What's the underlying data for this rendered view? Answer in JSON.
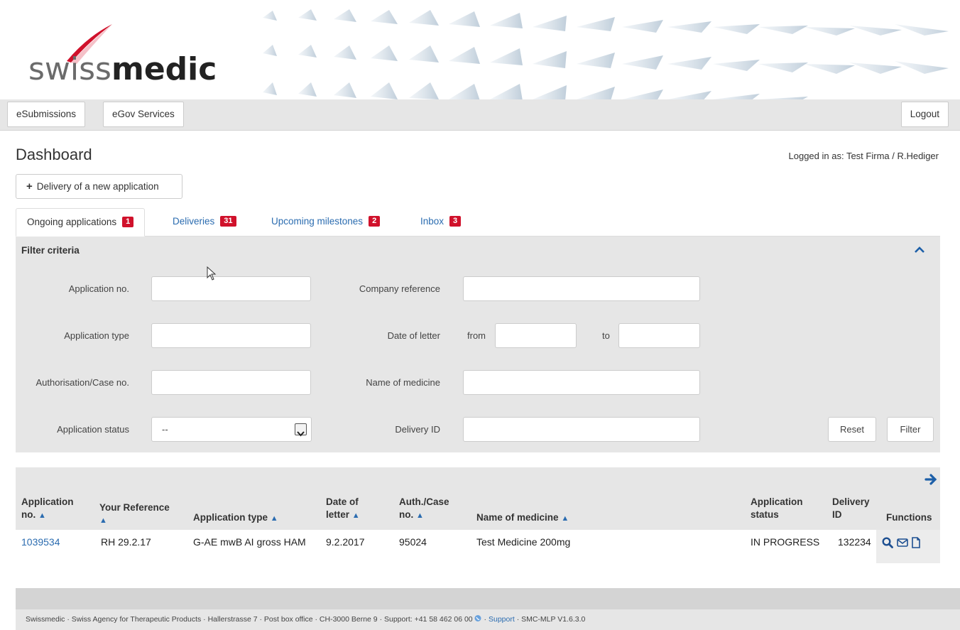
{
  "header": {
    "logo_light": "swiss",
    "logo_bold": "medic"
  },
  "topbar": {
    "esubmissions": "eSubmissions",
    "egov": "eGov Services",
    "logout": "Logout"
  },
  "page": {
    "title": "Dashboard",
    "logged_in": "Logged in as:  Test Firma /  R.Hediger",
    "new_app_label": "Delivery of a new application"
  },
  "tabs": [
    {
      "label": "Ongoing applications",
      "badge": "1"
    },
    {
      "label": "Deliveries",
      "badge": "31"
    },
    {
      "label": "Upcoming milestones",
      "badge": "2"
    },
    {
      "label": "Inbox",
      "badge": "3"
    }
  ],
  "filter": {
    "title": "Filter criteria",
    "application_no": "Application no.",
    "application_type": "Application type",
    "authorisation_case_no": "Authorisation/Case no.",
    "application_status": "Application status",
    "application_status_value": "--",
    "company_reference": "Company reference",
    "date_of_letter": "Date of letter",
    "from": "from",
    "to": "to",
    "name_of_medicine": "Name of medicine",
    "delivery_id": "Delivery ID",
    "reset": "Reset",
    "filter": "Filter"
  },
  "table": {
    "columns": {
      "app_no_1": "Application",
      "app_no_2": "no.",
      "your_ref": "Your Reference",
      "app_type": "Application type",
      "date_1": "Date of",
      "date_2": "letter",
      "auth_1": "Auth./Case",
      "auth_2": "no.",
      "medicine": "Name of medicine",
      "status_1": "Application",
      "status_2": "status",
      "delivery_1": "Delivery",
      "delivery_2": "ID",
      "functions": "Functions"
    },
    "rows": [
      {
        "app_no": "1039534",
        "your_ref": "RH 29.2.17",
        "app_type": "G-AE mwB AI gross HAM",
        "date": "9.2.2017",
        "auth": "95024",
        "medicine": "Test Medicine 200mg",
        "status": "IN PROGRESS",
        "delivery_id": "132234"
      }
    ]
  },
  "footer": {
    "text": "Swissmedic · Swiss Agency for Therapeutic Products · Hallerstrasse 7 · Post box office · CH-3000 Berne 9 · Support: +41 58 462 06 00",
    "support_link": "Support",
    "version": "· SMC-MLP V1.6.3.0"
  },
  "colors": {
    "accent": "#2b6cb0",
    "badge": "#d0112b",
    "panel": "#e6e6e6"
  }
}
